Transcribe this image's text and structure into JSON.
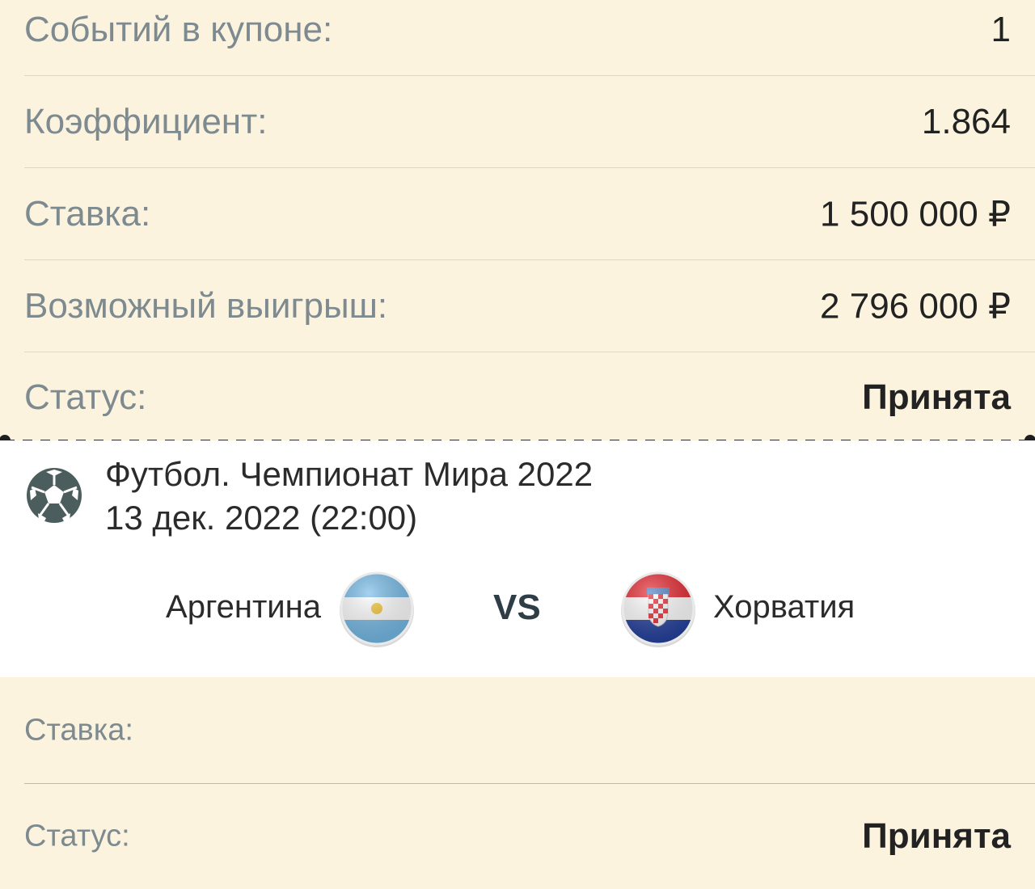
{
  "summary": {
    "events_label": "Событий в купоне:",
    "events_value": "1",
    "coef_label": "Коэффициент:",
    "coef_value": "1.864",
    "stake_label": "Ставка:",
    "stake_value": "1 500 000 ₽",
    "win_label": "Возможный выигрыш:",
    "win_value": "2 796 000 ₽",
    "status_label": "Статус:",
    "status_value": "Принята"
  },
  "event": {
    "sport_icon": "soccer-ball-icon",
    "title": "Футбол. Чемпионат Мира 2022",
    "datetime": "13 дек. 2022 (22:00)",
    "team_home": "Аргентина",
    "team_home_flag": "argentina-flag-icon",
    "vs": "VS",
    "team_away": "Хорватия",
    "team_away_flag": "croatia-flag-icon"
  },
  "details": {
    "stake_label": "Ставка:",
    "status_label": "Статус:",
    "status_value": "Принята"
  },
  "colors": {
    "background": "#fcf3df",
    "label": "#7d8a8f",
    "value": "#222222",
    "icon": "#4b5d5c"
  }
}
